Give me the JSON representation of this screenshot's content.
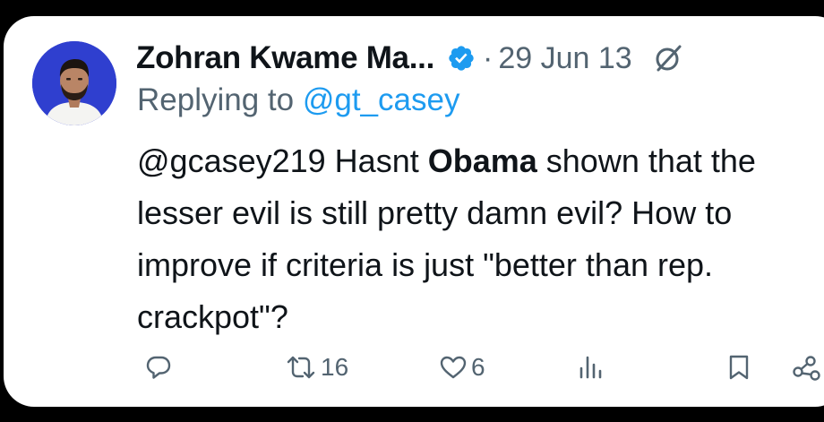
{
  "tweet": {
    "author_name": "Zohran Kwame Ma...",
    "separator": "·",
    "date": "29 Jun 13",
    "replying_prefix": "Replying to ",
    "replying_handle": "@gt_casey",
    "body_part1": "@gcasey219 Hasnt ",
    "body_bold": "Obama",
    "body_part2": " shown that the lesser evil is still pretty damn evil? How to improve if criteria is just \"better than rep. crackpot\"?"
  },
  "actions": {
    "reply_icon": "reply-icon",
    "retweet_icon": "retweet-icon",
    "retweet_count": "16",
    "like_icon": "like-icon",
    "like_count": "6",
    "views_icon": "views-icon",
    "bookmark_icon": "bookmark-icon",
    "share_icon": "share-icon"
  },
  "colors": {
    "text": "#0f1419",
    "muted": "#536471",
    "link": "#1d9bf0",
    "verified": "#1d9bf0",
    "avatar_bg": "#2f3fcf"
  }
}
